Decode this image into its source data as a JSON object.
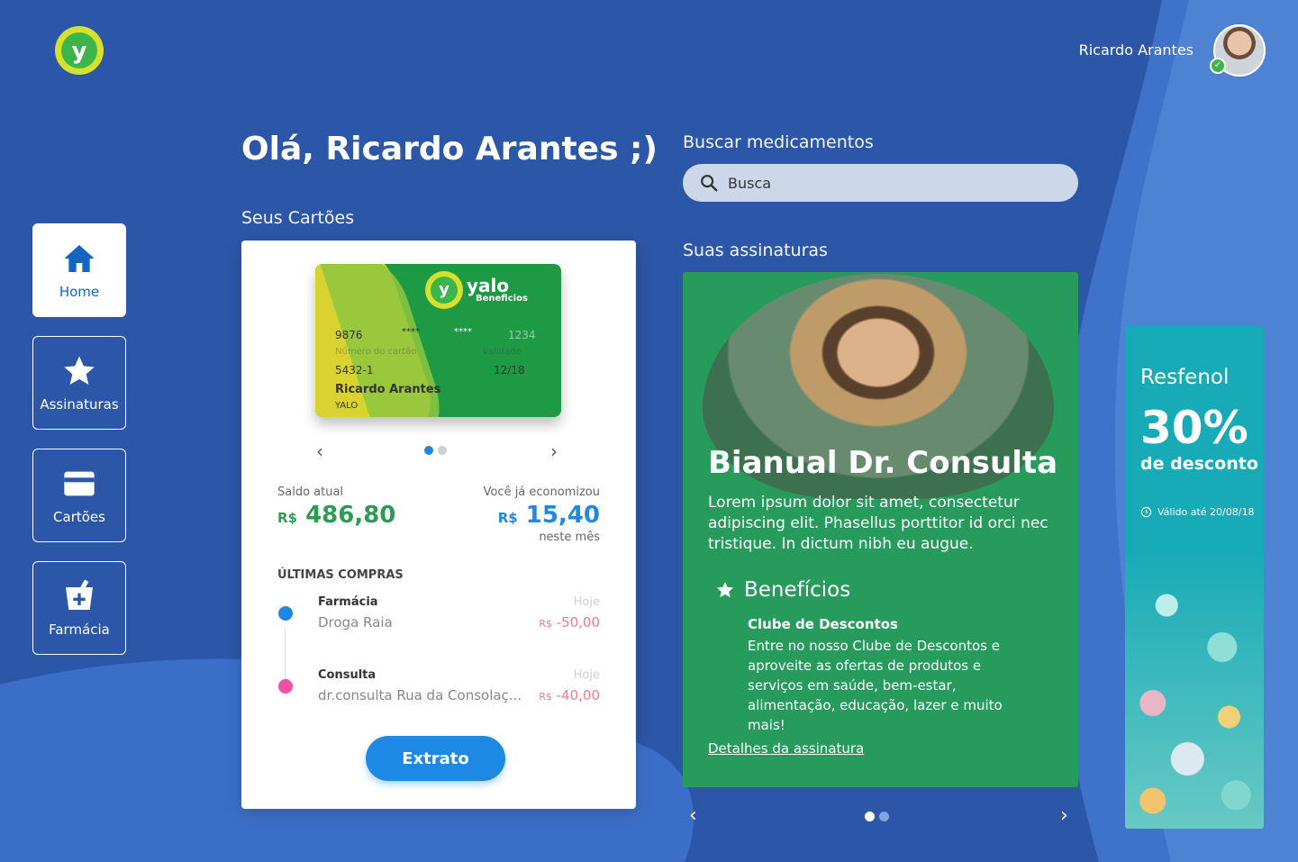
{
  "header": {
    "user_name": "Ricardo Arantes"
  },
  "sidebar": {
    "items": [
      {
        "label": "Home",
        "icon": "home-icon",
        "active": true
      },
      {
        "label": "Assinaturas",
        "icon": "star-icon",
        "active": false
      },
      {
        "label": "Cartões",
        "icon": "card-icon",
        "active": false
      },
      {
        "label": "Farmácia",
        "icon": "pharmacy-icon",
        "active": false
      }
    ]
  },
  "greeting": "Olá, Ricardo Arantes ;)",
  "cards_section": {
    "title": "Seus Cartões",
    "card": {
      "brand": "yalo",
      "brand_sub": "Beneficios",
      "number_start": "9876",
      "number_mask1": "****",
      "number_mask2": "****",
      "number_end": "1234",
      "number_label": "Número do cartão",
      "validity_label": "validade",
      "account": "5432-1",
      "expiry": "12/18",
      "holder": "Ricardo Arantes",
      "issuer": "YALO"
    },
    "saldo_label": "Saldo atual",
    "saldo_currency": "R$",
    "saldo_value": "486,80",
    "economia_label": "Você já economizou",
    "economia_currency": "R$",
    "economia_value": "15,40",
    "economia_period": "neste mês",
    "ultimas_label": "ÚLTIMAS COMPRAS",
    "transactions": [
      {
        "title": "Farmácia",
        "place": "Droga Raia",
        "date": "Hoje",
        "currency": "R$",
        "value": "-50,00"
      },
      {
        "title": "Consulta",
        "place": "dr.consulta Rua da Consolaç...",
        "date": "Hoje",
        "currency": "R$",
        "value": "-40,00"
      }
    ],
    "extrato_label": "Extrato"
  },
  "search": {
    "title": "Buscar medicamentos",
    "placeholder": "Busca"
  },
  "subscriptions": {
    "title": "Suas assinaturas",
    "card": {
      "name": "Bianual Dr. Consulta",
      "description": "Lorem ipsum dolor sit amet, consectetur adipiscing elit. Phasellus porttitor id orci nec tristique. In dictum nibh eu augue.",
      "benefits_title": "Benefícios",
      "benefit_name": "Clube de Descontos",
      "benefit_desc": "Entre no nosso Clube de Descontos e aproveite as ofertas de produtos e serviços em saúde, bem-estar, alimentação, educação, lazer e muito mais!",
      "link": "Detalhes da assinatura"
    }
  },
  "promo": {
    "name": "Resfenol",
    "percent": "30%",
    "discount_label": "de desconto",
    "valid": "Válido até 20/08/18"
  },
  "colors": {
    "background": "#2c57a8",
    "accent_blue": "#1e88e5",
    "green": "#269b5b",
    "teal": "#17aab7",
    "negative": "#f27a8a"
  }
}
